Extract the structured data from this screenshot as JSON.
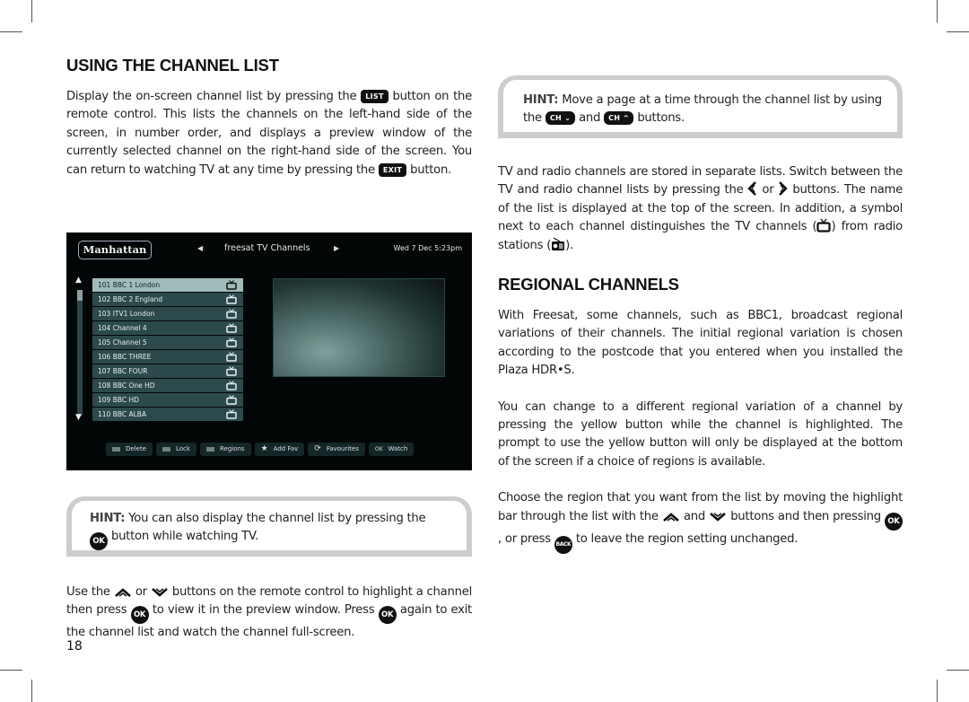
{
  "page_number": "18",
  "left": {
    "heading": "USING THE CHANNEL LIST",
    "intro": {
      "p1": "Display the on-screen channel list by pressing the",
      "list_key": "LIST",
      "p2": "button on the remote control. This lists the channels on the left-hand side of the screen, in number order, and displays a preview window of the currently selected channel on the right-hand side of the screen. You can return to watching TV at any time by pressing the",
      "exit_key": "EXIT",
      "p3": "button."
    },
    "hint": {
      "label": "HINT:",
      "text1": "You can also display the channel list by pressing the",
      "ok_key": "OK",
      "text2": "button while watching TV."
    },
    "usage": {
      "t1": "Use the",
      "t2": "or",
      "t3": "buttons on the remote control to highlight a channel then press",
      "ok_key": "OK",
      "t4": "to view it in the preview window. Press",
      "t5": "again to exit the channel list and watch the channel full-screen."
    }
  },
  "tv_screen": {
    "logo": "Manhattan",
    "list_title": "freesat TV Channels",
    "date_time": "Wed 7 Dec 5:23pm",
    "channels": [
      {
        "num": "101",
        "name": "BBC 1 London",
        "selected": true
      },
      {
        "num": "102",
        "name": "BBC 2 England"
      },
      {
        "num": "103",
        "name": "ITV1 London"
      },
      {
        "num": "104",
        "name": "Channel 4"
      },
      {
        "num": "105",
        "name": "Channel 5"
      },
      {
        "num": "106",
        "name": "BBC THREE"
      },
      {
        "num": "107",
        "name": "BBC FOUR"
      },
      {
        "num": "108",
        "name": "BBC One HD"
      },
      {
        "num": "109",
        "name": "BBC HD"
      },
      {
        "num": "110",
        "name": "BBC ALBA"
      }
    ],
    "buttons": [
      {
        "label": "Delete",
        "icon": "color-swatch"
      },
      {
        "label": "Lock",
        "icon": "color-swatch"
      },
      {
        "label": "Regions",
        "icon": "color-swatch"
      },
      {
        "label": "Add Fav",
        "icon": "star-icon"
      },
      {
        "label": "Favourites",
        "icon": "cycle-icon"
      },
      {
        "label": "Watch",
        "icon": "OK"
      }
    ]
  },
  "right": {
    "hint": {
      "label": "HINT:",
      "text1": "Move a page at a time through the channel list by using the",
      "ch_down_key": "CH",
      "and": "and",
      "ch_up_key": "CH",
      "text2": "buttons."
    },
    "lists_para": {
      "t1": "TV and radio channels are stored in separate lists. Switch between the TV and radio channel lists by pressing the",
      "t2": "or",
      "t3": "buttons. The name of the list is displayed at the top of the screen. In addition, a symbol next to each channel distinguishes the TV channels (",
      "t4": ") from radio stations (",
      "t5": ")."
    },
    "heading": "REGIONAL CHANNELS",
    "para1": "With Freesat, some channels, such as BBC1, broadcast regional variations of their channels. The initial regional variation is chosen according to the postcode that you entered when you installed the Plaza HDR•S.",
    "para2": "You can change to a different regional variation of a channel by pressing the yellow button while the channel is highlighted. The prompt to use the yellow button will only be displayed at the bottom of the screen if a choice of regions is available.",
    "para3": {
      "t1": "Choose the region that you want from the list by moving the highlight bar through the list with the",
      "t2": "and",
      "t3": "buttons and then pressing",
      "ok_key": "OK",
      "t4": ", or press",
      "back_key": "BACK",
      "t5": "to leave the region setting unchanged."
    }
  }
}
